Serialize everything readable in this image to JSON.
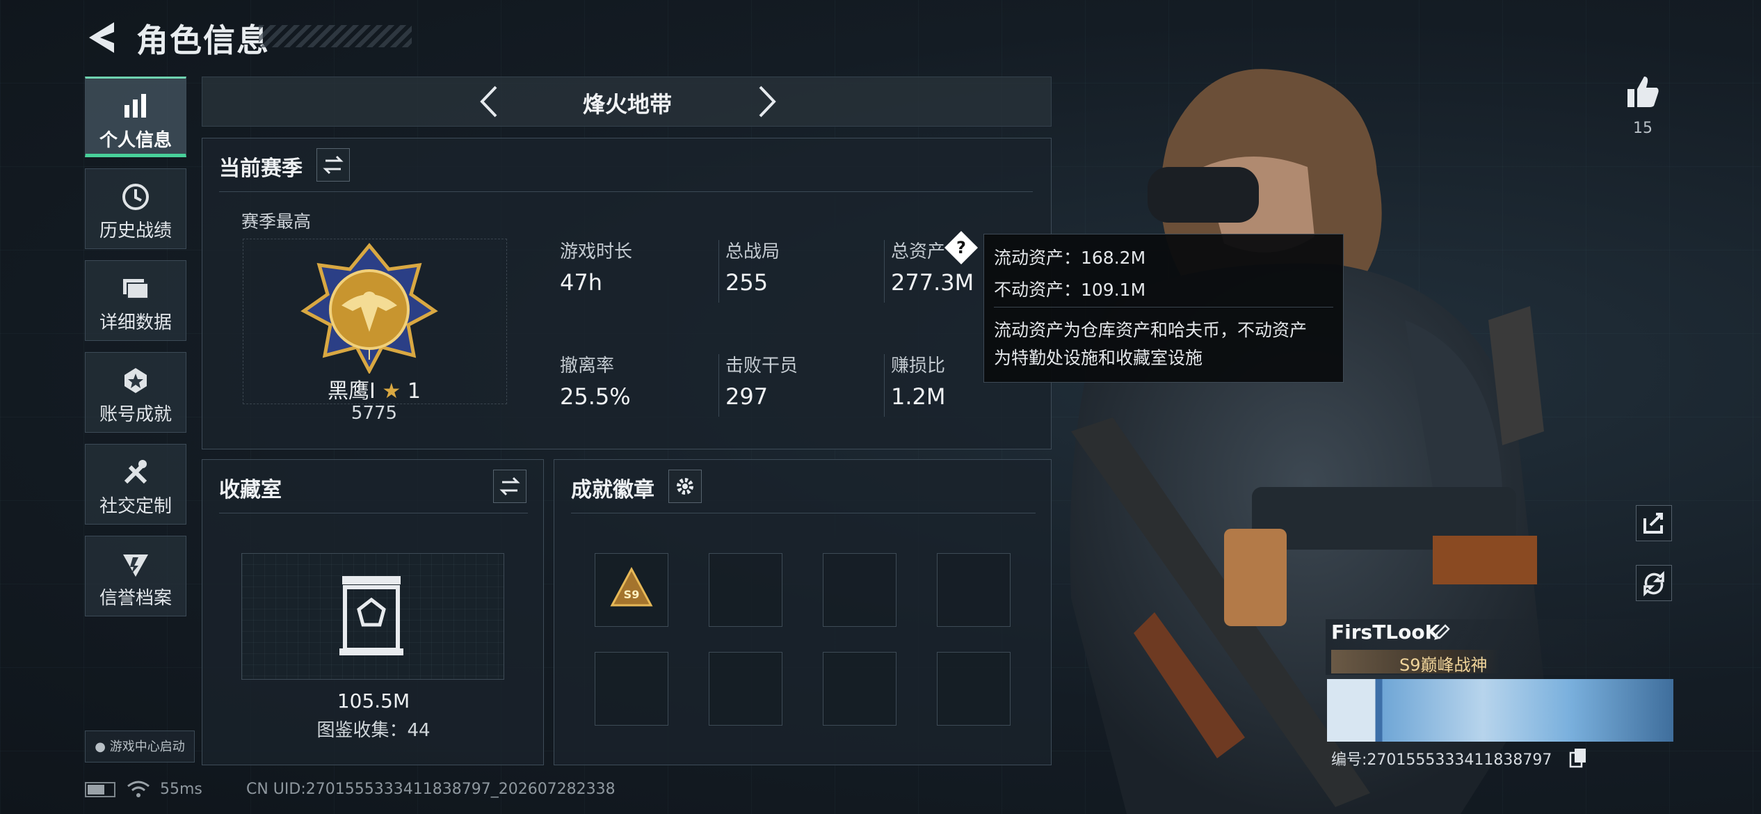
{
  "header": {
    "title": "角色信息"
  },
  "nav": [
    {
      "label": "个人信息",
      "icon": "bar-chart-icon",
      "active": true
    },
    {
      "label": "历史战绩",
      "icon": "clock-icon"
    },
    {
      "label": "详细数据",
      "icon": "folder-icon"
    },
    {
      "label": "账号成就",
      "icon": "achievement-icon"
    },
    {
      "label": "社交定制",
      "icon": "tools-icon"
    },
    {
      "label": "信誉档案",
      "icon": "shield-icon"
    }
  ],
  "launch_label": "游戏中心启动",
  "mode": {
    "title": "烽火地带"
  },
  "season": {
    "title": "当前赛季",
    "best_label": "赛季最高",
    "rank_name": "黑鹰I",
    "rank_stars": "1",
    "rank_points": "5775",
    "stats": [
      {
        "label": "游戏时长",
        "value": "47h"
      },
      {
        "label": "总战局",
        "value": "255"
      },
      {
        "label": "总资产",
        "value": "277.3M"
      },
      {
        "label": "撤离率",
        "value": "25.5%"
      },
      {
        "label": "击败干员",
        "value": "297"
      },
      {
        "label": "赚损比",
        "value": "1.2M"
      }
    ]
  },
  "tooltip": {
    "line1": "流动资产：168.2M",
    "line2": "不动资产：109.1M",
    "line3": "流动资产为仓库资产和哈夫币，不动资产",
    "line4": "为特勤处设施和收藏室设施"
  },
  "collection": {
    "title": "收藏室",
    "value": "105.5M",
    "count": "图鉴收集：44"
  },
  "badges": {
    "title": "成就徽章"
  },
  "likes": "15",
  "player": {
    "name": "FirsTLooK",
    "title_badge": "S9巅峰战神",
    "id_label": "编号:270155533341183879​7"
  },
  "status": {
    "ping": "55ms",
    "uid": "CN UID:2701555333411838797_202607282338"
  },
  "colors": {
    "accent": "#48d19a",
    "rank_gold": "#d9a842"
  }
}
